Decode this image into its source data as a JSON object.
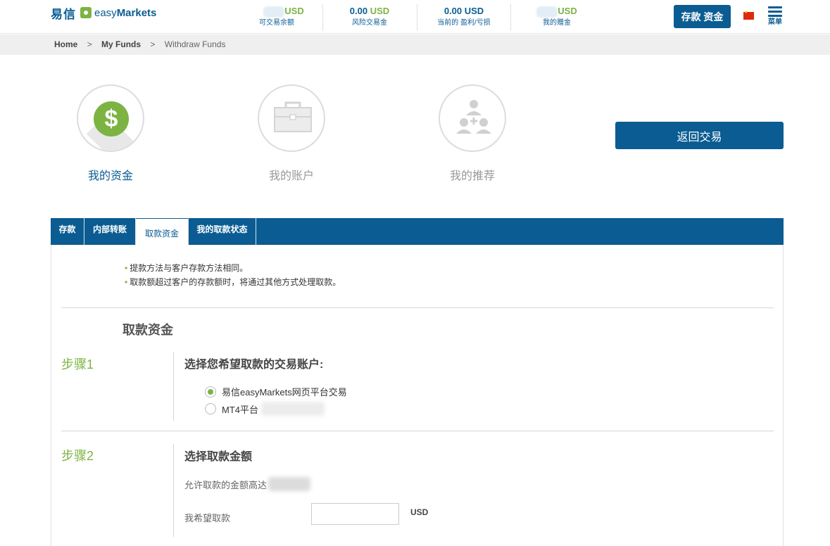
{
  "logo": {
    "cn": "易信",
    "en_light": "easy",
    "en_bold": "Markets"
  },
  "header": {
    "stats": [
      {
        "value": "",
        "currency": "USD",
        "label": "可交易余额"
      },
      {
        "value": "0.00",
        "currency": "USD",
        "label": "风险交易金"
      },
      {
        "value": "0.00 USD",
        "currency": "",
        "label": "当前的 盈利/亏损"
      },
      {
        "value": "",
        "currency": "USD",
        "label": "我的赠金"
      }
    ],
    "deposit_label": "存款 资金",
    "menu_label": "菜单"
  },
  "breadcrumb": {
    "home": "Home",
    "funds": "My Funds",
    "current": "Withdraw Funds",
    "sep": ">"
  },
  "sections": [
    {
      "label": "我的资金",
      "icon": "dollar-icon",
      "active": true
    },
    {
      "label": "我的账户",
      "icon": "briefcase-icon",
      "active": false
    },
    {
      "label": "我的推荐",
      "icon": "referral-icon",
      "active": false
    }
  ],
  "back_label": "返回交易",
  "tabs": [
    {
      "label": "存款"
    },
    {
      "label": "内部转账"
    },
    {
      "label": "取款资金"
    },
    {
      "label": "我的取款状态"
    }
  ],
  "notes": [
    "提款方法与客户存款方法相同。",
    "取款额超过客户的存款额时，将通过其他方式处理取款。"
  ],
  "panel_title": "取款资金",
  "step1": {
    "label": "步骤1",
    "title": "选择您希望取款的交易账户:",
    "options": [
      {
        "label": "易信easyMarkets网页平台交易",
        "checked": true
      },
      {
        "label": "MT4平台",
        "checked": false
      }
    ]
  },
  "step2": {
    "label": "步骤2",
    "title": "选择取款金额",
    "allowed_label": "允许取款的金额高达",
    "want_label": "我希望取款",
    "amount_value": "",
    "currency": "USD"
  },
  "colors": {
    "primary": "#0a5c92",
    "accent": "#7cb342"
  }
}
